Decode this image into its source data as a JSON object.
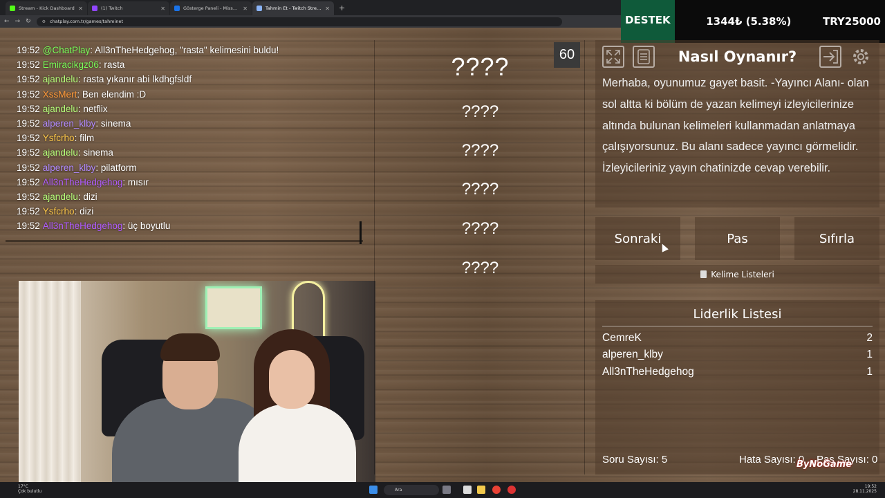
{
  "browser": {
    "tabs": [
      {
        "label": "Stream - Kick Dashboard",
        "color": "#53fc18",
        "active": false
      },
      {
        "label": "(1) Twitch",
        "color": "#9146ff",
        "active": false
      },
      {
        "label": "Gösterge Paneli - MissKss Al B...",
        "color": "#1a73e8",
        "active": false
      },
      {
        "label": "Tahmin Et - Twitch Stream Gam...",
        "color": "#8ab4f8",
        "active": true
      }
    ],
    "url": "chatplay.com.tr/games/tahminet"
  },
  "ticker": {
    "label": "DESTEK",
    "change": "1344₺ (5.38%)",
    "goal": "TRY25000"
  },
  "chat": {
    "messages": [
      {
        "time": "19:52",
        "user": "@ChatPlay",
        "color": "#7bff5a",
        "text": ": All3nTheHedgehog, \"rasta\" kelimesini buldu!"
      },
      {
        "time": "19:52",
        "user": "Emiracikgz06",
        "color": "#7bff5a",
        "text": ": rasta"
      },
      {
        "time": "19:52",
        "user": "ajandelu",
        "color": "#b6ff7a",
        "text": ": rasta yıkanır abi lkdhgfsldf"
      },
      {
        "time": "19:52",
        "user": "XssMert",
        "color": "#ff9a3a",
        "text": ": Ben elendim :D"
      },
      {
        "time": "19:52",
        "user": "ajandelu",
        "color": "#b6ff7a",
        "text": ": netflix"
      },
      {
        "time": "19:52",
        "user": "alperen_klby",
        "color": "#b28bff",
        "text": ": sinema"
      },
      {
        "time": "19:52",
        "user": "Ysfcrho",
        "color": "#ffc94a",
        "text": ": film"
      },
      {
        "time": "19:52",
        "user": "ajandelu",
        "color": "#b6ff7a",
        "text": ": sinema"
      },
      {
        "time": "19:52",
        "user": "alperen_klby",
        "color": "#b28bff",
        "text": ": pilatform"
      },
      {
        "time": "19:52",
        "user": "All3nTheHedgehog",
        "color": "#b15cff",
        "text": ": mısır"
      },
      {
        "time": "19:52",
        "user": "ajandelu",
        "color": "#b6ff7a",
        "text": ": dizi"
      },
      {
        "time": "19:52",
        "user": "Ysfcrho",
        "color": "#ffc94a",
        "text": ": dizi"
      },
      {
        "time": "19:52",
        "user": "All3nTheHedgehog",
        "color": "#b15cff",
        "text": ": üç boyutlu"
      }
    ]
  },
  "game": {
    "main_word": "????",
    "hidden_words": [
      "????",
      "????",
      "????",
      "????",
      "????"
    ],
    "timer": "60"
  },
  "help": {
    "title": "Nasıl Oynanır?",
    "text": "Merhaba, oyunumuz gayet basit. -Yayıncı Alanı- olan sol altta ki bölüm de yazan kelimeyi izleyicilerinize altında bulunan kelimeleri kullanmadan anlatmaya çalışıyorsunuz. Bu alanı sadece yayıncı görmelidir. İzleyicileriniz yayın chatinizde cevap verebilir."
  },
  "actions": {
    "next": "Sonraki",
    "pass": "Pas",
    "reset": "Sıfırla",
    "word_lists": "Kelime Listeleri"
  },
  "leaderboard": {
    "title": "Liderlik Listesi",
    "rows": [
      {
        "name": "CemreK",
        "score": "2"
      },
      {
        "name": "alperen_klby",
        "score": "1"
      },
      {
        "name": "All3nTheHedgehog",
        "score": "1"
      }
    ]
  },
  "stats": {
    "questions": "Soru Sayısı: 5",
    "errors": "Hata Sayısı: 0",
    "passes": "Pas Sayısı: 0"
  },
  "watermark": "ByNoGame",
  "taskbar": {
    "weather_temp": "17°C",
    "weather_desc": "Çok bulutlu",
    "search": "Ara",
    "time": "19:52",
    "date": "28.11.2025"
  }
}
